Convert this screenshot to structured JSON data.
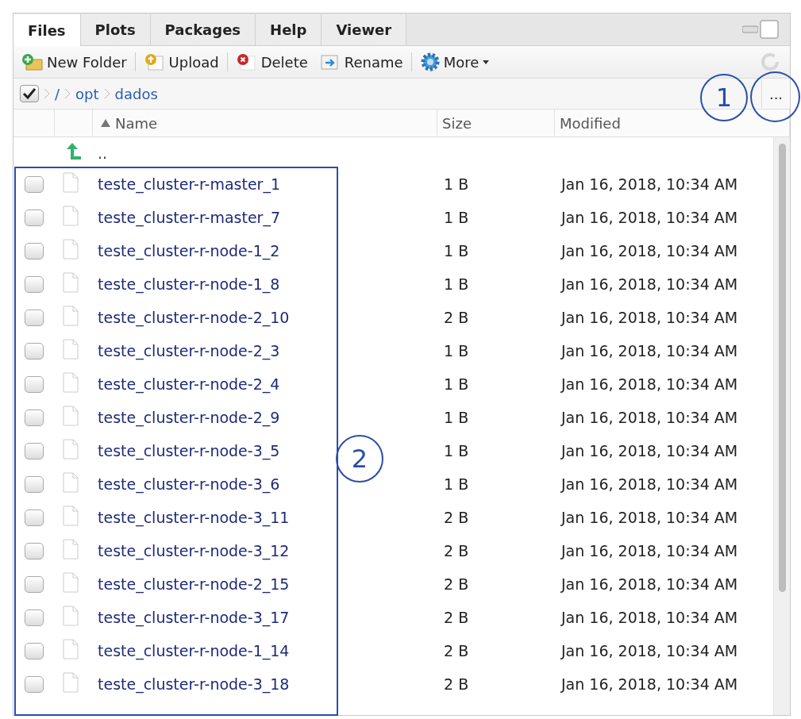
{
  "tabs": [
    {
      "label": "Files",
      "selected": true
    },
    {
      "label": "Plots",
      "selected": false
    },
    {
      "label": "Packages",
      "selected": false
    },
    {
      "label": "Help",
      "selected": false
    },
    {
      "label": "Viewer",
      "selected": false
    }
  ],
  "toolbar": [
    {
      "label": "New Folder",
      "kind": "new-folder"
    },
    {
      "label": "Upload",
      "kind": "upload"
    },
    {
      "label": "Delete",
      "kind": "delete"
    },
    {
      "label": "Rename",
      "kind": "rename"
    },
    {
      "label": "More",
      "kind": "more"
    }
  ],
  "breadcrumb": {
    "checked": true,
    "parts": [
      "/",
      "opt",
      "dados"
    ]
  },
  "more_button": "...",
  "columns": [
    {
      "label": "Name",
      "sorted": true
    },
    {
      "label": "Size",
      "sorted": false
    },
    {
      "label": "Modified",
      "sorted": false
    }
  ],
  "parent_row": {
    "name": ".."
  },
  "rows": [
    {
      "name": "teste_cluster-r-master_1",
      "size": "1 B",
      "modified": "Jan 16, 2018, 10:34 AM",
      "checked": false
    },
    {
      "name": "teste_cluster-r-master_7",
      "size": "1 B",
      "modified": "Jan 16, 2018, 10:34 AM",
      "checked": false
    },
    {
      "name": "teste_cluster-r-node-1_2",
      "size": "1 B",
      "modified": "Jan 16, 2018, 10:34 AM",
      "checked": false
    },
    {
      "name": "teste_cluster-r-node-1_8",
      "size": "1 B",
      "modified": "Jan 16, 2018, 10:34 AM",
      "checked": false
    },
    {
      "name": "teste_cluster-r-node-2_10",
      "size": "2 B",
      "modified": "Jan 16, 2018, 10:34 AM",
      "checked": false
    },
    {
      "name": "teste_cluster-r-node-2_3",
      "size": "1 B",
      "modified": "Jan 16, 2018, 10:34 AM",
      "checked": false
    },
    {
      "name": "teste_cluster-r-node-2_4",
      "size": "1 B",
      "modified": "Jan 16, 2018, 10:34 AM",
      "checked": false
    },
    {
      "name": "teste_cluster-r-node-2_9",
      "size": "1 B",
      "modified": "Jan 16, 2018, 10:34 AM",
      "checked": false
    },
    {
      "name": "teste_cluster-r-node-3_5",
      "size": "1 B",
      "modified": "Jan 16, 2018, 10:34 AM",
      "checked": false
    },
    {
      "name": "teste_cluster-r-node-3_6",
      "size": "1 B",
      "modified": "Jan 16, 2018, 10:34 AM",
      "checked": false
    },
    {
      "name": "teste_cluster-r-node-3_11",
      "size": "2 B",
      "modified": "Jan 16, 2018, 10:34 AM",
      "checked": false
    },
    {
      "name": "teste_cluster-r-node-3_12",
      "size": "2 B",
      "modified": "Jan 16, 2018, 10:34 AM",
      "checked": false
    },
    {
      "name": "teste_cluster-r-node-2_15",
      "size": "2 B",
      "modified": "Jan 16, 2018, 10:34 AM",
      "checked": false
    },
    {
      "name": "teste_cluster-r-node-3_17",
      "size": "2 B",
      "modified": "Jan 16, 2018, 10:34 AM",
      "checked": false
    },
    {
      "name": "teste_cluster-r-node-1_14",
      "size": "2 B",
      "modified": "Jan 16, 2018, 10:34 AM",
      "checked": false
    },
    {
      "name": "teste_cluster-r-node-3_18",
      "size": "2 B",
      "modified": "Jan 16, 2018, 10:34 AM",
      "checked": false
    }
  ],
  "annotations": [
    {
      "label": "1"
    },
    {
      "label": "2"
    }
  ]
}
